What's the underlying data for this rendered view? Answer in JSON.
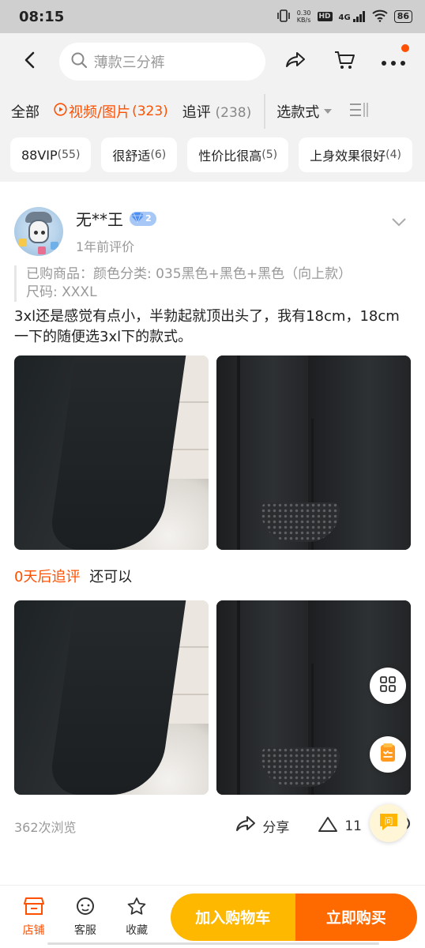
{
  "status_bar": {
    "time": "08:15",
    "network_speed_value": "0.30",
    "network_speed_unit": "KB/s",
    "hd_label": "HD",
    "network_type": "4G",
    "battery": "86"
  },
  "header": {
    "search_placeholder": "薄款三分裤",
    "icons": [
      "back-icon",
      "search-icon",
      "share-icon",
      "cart-icon",
      "more-icon"
    ],
    "accent_color": "#ff5000"
  },
  "filter_tabs": [
    {
      "label": "全部",
      "count": ""
    },
    {
      "label": "视频/图片",
      "count": "(323)"
    },
    {
      "label": "追评",
      "count": "(238)"
    }
  ],
  "select_style_label": "选款式",
  "chips": [
    {
      "label": "88VIP",
      "count": "(55)"
    },
    {
      "label": "很舒适",
      "count": "(6)"
    },
    {
      "label": "性价比很高",
      "count": "(5)"
    },
    {
      "label": "上身效果很好",
      "count": "(4)"
    }
  ],
  "review": {
    "reviewer_name": "无**王",
    "level": "2",
    "time_label": "1年前评价",
    "purchased_line1": "已购商品：颜色分类: 035黑色+黑色+黑色（向上款）",
    "purchased_line2": "尺码: XXXL",
    "text": "3xl还是感觉有点小，半勃起就顶出头了，我有18cm，18cm一下的随便选3xl下的款式。",
    "followup_label": "0天后追评",
    "followup_text": "还可以",
    "views": "362次浏览",
    "share_label": "分享",
    "like_count": "11"
  },
  "bottom_bar": {
    "shop_label": "店铺",
    "service_label": "客服",
    "favorite_label": "收藏",
    "add_to_cart_label": "加入购物车",
    "buy_now_label": "立即购买"
  }
}
